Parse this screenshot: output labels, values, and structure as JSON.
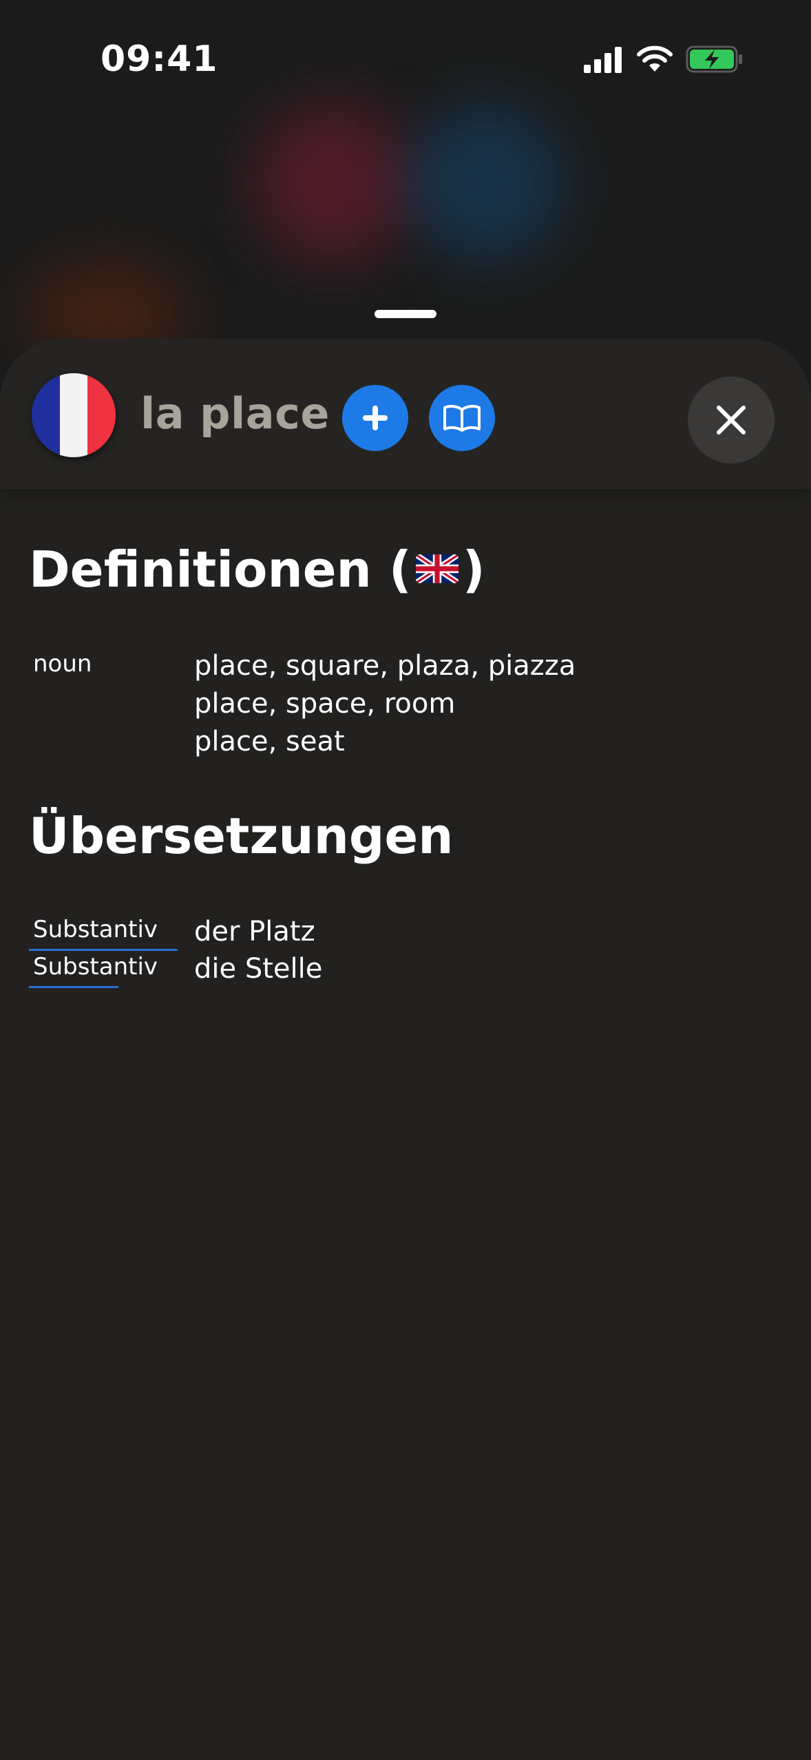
{
  "status_bar": {
    "time": "09:41"
  },
  "header": {
    "word": "la place",
    "source_flag": "france-flag",
    "icons": {
      "add": "plus-icon",
      "dictionary": "book-icon",
      "close": "close-icon"
    }
  },
  "definitions": {
    "title": "Definitionen",
    "open_paren": "(",
    "close_paren": ")",
    "language_flag": "uk-flag",
    "entries": [
      {
        "pos": "noun",
        "meanings": [
          "place, square, plaza, piazza",
          "place, space, room",
          "place, seat"
        ]
      }
    ]
  },
  "translations": {
    "title": "Übersetzungen",
    "entries": [
      {
        "pos": "Substantiv",
        "word": "der Platz"
      },
      {
        "pos": "Substantiv",
        "word": "die Stelle"
      }
    ]
  },
  "colors": {
    "accent": "#1e7ae6",
    "sheet_background": "#22211f",
    "underline": "#2a6fd9"
  }
}
